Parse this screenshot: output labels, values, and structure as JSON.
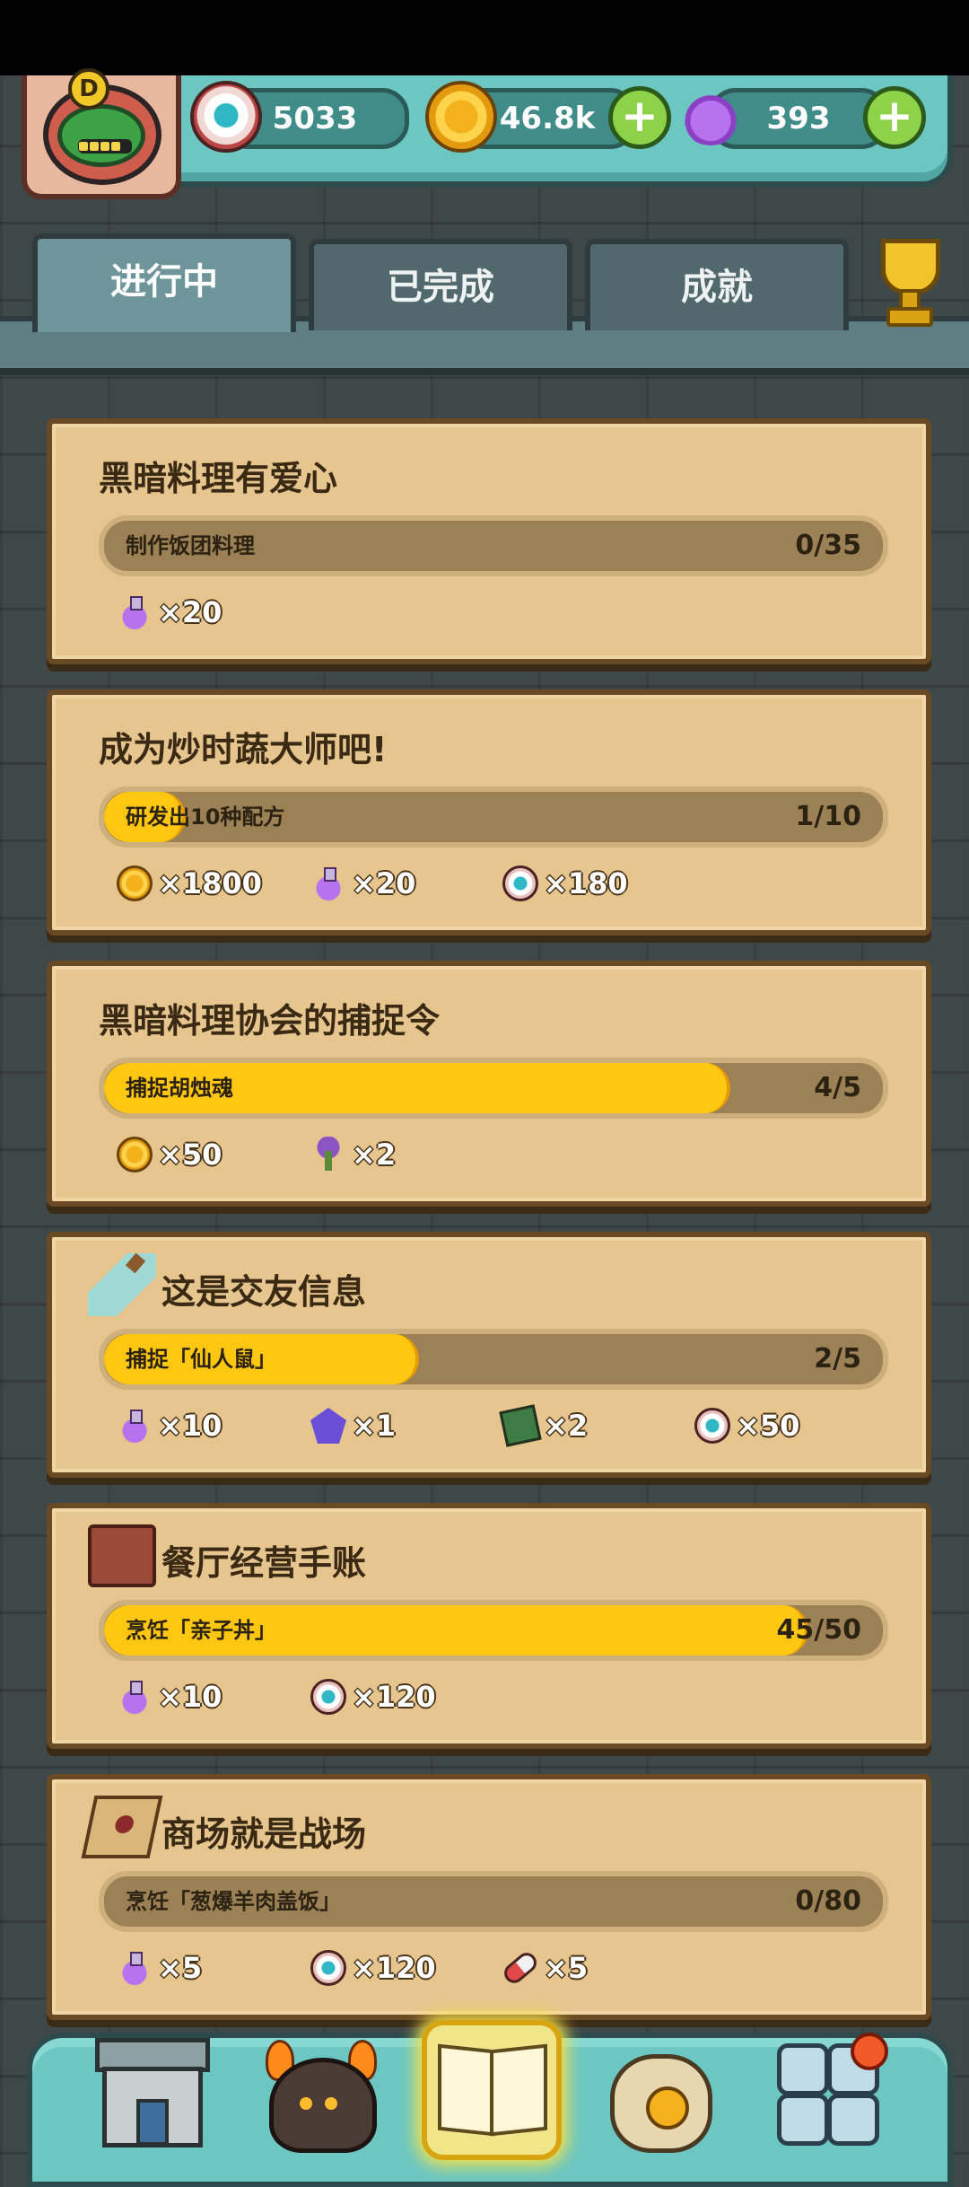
{
  "resources": {
    "eyeballs": "5033",
    "coins": "46.8k",
    "potions": "393",
    "plus_label": "+"
  },
  "avatar": {
    "badge": "D"
  },
  "tabs": [
    {
      "label": "进行中",
      "active": true
    },
    {
      "label": "已完成",
      "active": false
    },
    {
      "label": "成就",
      "active": false
    }
  ],
  "quests": [
    {
      "title": "黑暗料理有爱心",
      "icon": null,
      "task": "制作饭团料理",
      "count": "0/35",
      "progress": 0.0,
      "rewards": [
        {
          "icon": "potion",
          "qty": "×20"
        }
      ]
    },
    {
      "title": "成为炒时蔬大师吧!",
      "icon": null,
      "task": "研发出10种配方",
      "count": "1/10",
      "progress": 0.1,
      "rewards": [
        {
          "icon": "coin",
          "qty": "×1800"
        },
        {
          "icon": "potion",
          "qty": "×20"
        },
        {
          "icon": "eye",
          "qty": "×180"
        }
      ]
    },
    {
      "title": "黑暗料理协会的捕捉令",
      "icon": null,
      "task": "捕捉胡烛魂",
      "count": "4/5",
      "progress": 0.8,
      "rewards": [
        {
          "icon": "coin",
          "qty": "×50"
        },
        {
          "icon": "mushroom",
          "qty": "×2"
        }
      ]
    },
    {
      "title": "这是交友信息",
      "icon": "bottle-icon",
      "task": "捕捉「仙人鼠」",
      "count": "2/5",
      "progress": 0.4,
      "rewards": [
        {
          "icon": "potion",
          "qty": "×10"
        },
        {
          "icon": "gem",
          "qty": "×1"
        },
        {
          "icon": "board",
          "qty": "×2"
        },
        {
          "icon": "eye",
          "qty": "×50"
        }
      ]
    },
    {
      "title": "餐厅经营手账",
      "icon": "book-icon",
      "task": "烹饪「亲子丼」",
      "count": "45/50",
      "progress": 0.9,
      "rewards": [
        {
          "icon": "potion",
          "qty": "×10"
        },
        {
          "icon": "eye",
          "qty": "×120"
        }
      ]
    },
    {
      "title": "商场就是战场",
      "icon": "map-icon",
      "task": "烹饪「葱爆羊肉盖饭」",
      "count": "0/80",
      "progress": 0.0,
      "rewards": [
        {
          "icon": "potion",
          "qty": "×5"
        },
        {
          "icon": "eye",
          "qty": "×120"
        },
        {
          "icon": "pill",
          "qty": "×5"
        }
      ]
    }
  ],
  "bottom_nav": [
    {
      "name": "restaurant-nav-icon"
    },
    {
      "name": "monster-nav-icon"
    },
    {
      "name": "quest-book-nav-icon",
      "active": true
    },
    {
      "name": "money-bag-nav-icon"
    },
    {
      "name": "grid-menu-nav-icon"
    }
  ]
}
